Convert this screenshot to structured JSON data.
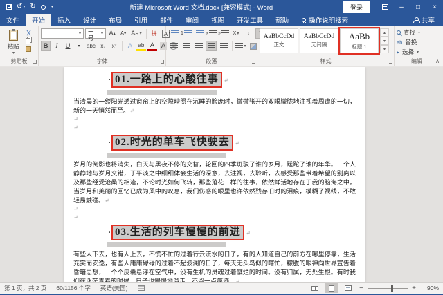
{
  "titlebar": {
    "title": "新建 Microsoft Word 文档.docx [兼容模式] - Word",
    "signin": "登录"
  },
  "tabs": {
    "file": "文件",
    "items": [
      "开始",
      "插入",
      "设计",
      "布局",
      "引用",
      "邮件",
      "审阅",
      "视图",
      "开发工具",
      "帮助"
    ],
    "active": "开始",
    "tellme": "操作说明搜索",
    "share": "共享"
  },
  "ribbon": {
    "clipboard": {
      "label": "剪贴板",
      "paste": "粘贴"
    },
    "font": {
      "label": "字体",
      "name_value": "",
      "size_value": "二号",
      "bold": "B",
      "italic": "I",
      "underline": "U",
      "strike": "abc",
      "subscript": "x₂",
      "superscript": "x²",
      "grow": "A",
      "shrink": "A",
      "change_case": "Aa",
      "phonetic": "拼",
      "char_border": "A",
      "text_effects": "A",
      "highlight": "ab",
      "font_color": "A",
      "char_shading": "A",
      "enclose": "字"
    },
    "paragraph": {
      "label": "段落",
      "show_marks": "¶",
      "cn_layout": "X",
      "sort": "↓"
    },
    "styles": {
      "label": "样式",
      "items": [
        {
          "preview": "AaBbCcDd",
          "name": "正文"
        },
        {
          "preview": "AaBbCcDd",
          "name": "无间隔"
        },
        {
          "preview": "AaBb",
          "name": "标题 1"
        }
      ]
    },
    "editing": {
      "label": "编辑",
      "find": "查找",
      "replace": "替换",
      "select": "选择"
    }
  },
  "document": {
    "bullet": "·",
    "pilcrow": "↵",
    "sections": [
      {
        "heading": "01.一路上的心酸往事",
        "body": "当清晨的一缕阳光透过窗帘上的空隙映照在沉睡的脸庞时，微微张开的双眼朦胧地注视着周遭的一切，新的一天悄然而至。"
      },
      {
        "heading": "02.时光的单车飞快驶去",
        "body": "岁月的倒影也将消失，白天与黑夜不停的交替，轮回的四季斑驳了谁的岁月，蹉跎了谁的年华。一个人静静地与岁月交错，于平淡之中细细体会生活的深意，去注视，去聆听，去感受那些带着希望的别离以及那些经受沧桑的相逢，不论时光如何飞转，那些落花一样的往事，依然鲜活地存在于我的脑海之中。当岁月和美丽的回忆已成为风中的叹息，我们伤感的眼里也许依然残存旧时的泪痕，模糊了视线，不敢轻易触碰。"
      },
      {
        "heading": "03.生活的列车慢慢的前进",
        "body": "有些人下去，也有人上去，不慌不忙的过着行云流水的日子，有的人知道自己的前方在哪里停靠，生活充实而安逸，有些人庸庸碌碌的过着不起波澜的日子，每天无头鸟似的瞎忙，朦胧的眼神向世界宣告着昏暗思想，一个个皮囊悬浮在空气中，没有生机的灵魂过着糜烂的时间。没有归属，无处生根。有时我们在迷茫青春的时候，日子也慢慢地溜走，不留一点痕迹。"
      }
    ]
  },
  "statusbar": {
    "page": "第 1 页，共 2 页",
    "words": "60/1156 个字",
    "language": "英语(美国)",
    "zoom": "90%",
    "zoom_out": "−",
    "zoom_in": "+"
  },
  "icons": {
    "dropdown": "▾",
    "undo": "↺",
    "redo": "↻",
    "minimize": "–",
    "maximize": "□",
    "close": "×",
    "collapse_ribbon": "∧",
    "up": "▴",
    "down": "▾",
    "select_pointer": "▸"
  },
  "colors": {
    "accent": "#2b579a",
    "annotation_red": "#e03024",
    "selection_gray": "#cccbca",
    "ribbon_bg": "#f3f2f1",
    "canvas_bg": "#e3e1df"
  }
}
